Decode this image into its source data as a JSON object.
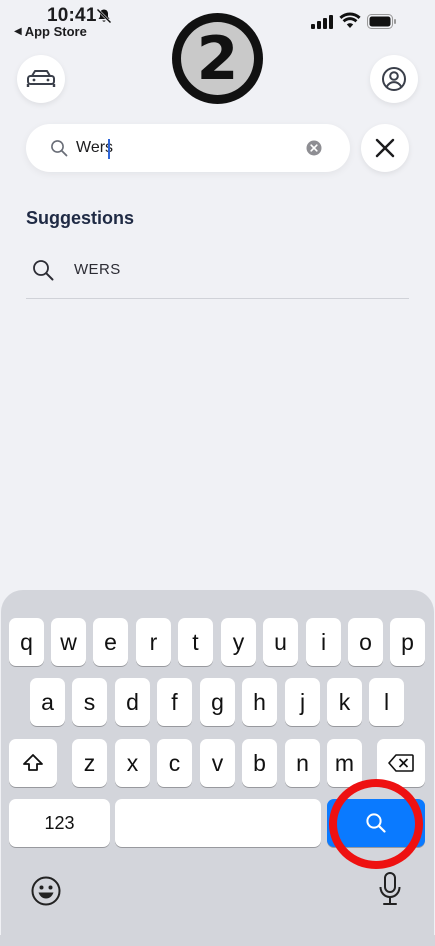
{
  "status_bar": {
    "time": "10:41",
    "back_app": "App Store",
    "back_arrow": "◀"
  },
  "step_badge": "2",
  "top_bar": {
    "left_icon": "car-icon",
    "right_icon": "profile-icon"
  },
  "search": {
    "value": "Wers",
    "placeholder": "",
    "clear_icon": "clear-icon",
    "close_icon": "close-icon"
  },
  "suggestions": {
    "title": "Suggestions",
    "items": [
      {
        "text": "WERS",
        "icon": "search-icon"
      }
    ]
  },
  "keyboard": {
    "row1": [
      "q",
      "w",
      "e",
      "r",
      "t",
      "y",
      "u",
      "i",
      "o",
      "p"
    ],
    "row2": [
      "a",
      "s",
      "d",
      "f",
      "g",
      "h",
      "j",
      "k",
      "l"
    ],
    "row3": [
      "z",
      "x",
      "c",
      "v",
      "b",
      "n",
      "m"
    ],
    "numbers_key": "123",
    "accent_color": "#0a7aff"
  },
  "annotation_color": "#ee1111"
}
